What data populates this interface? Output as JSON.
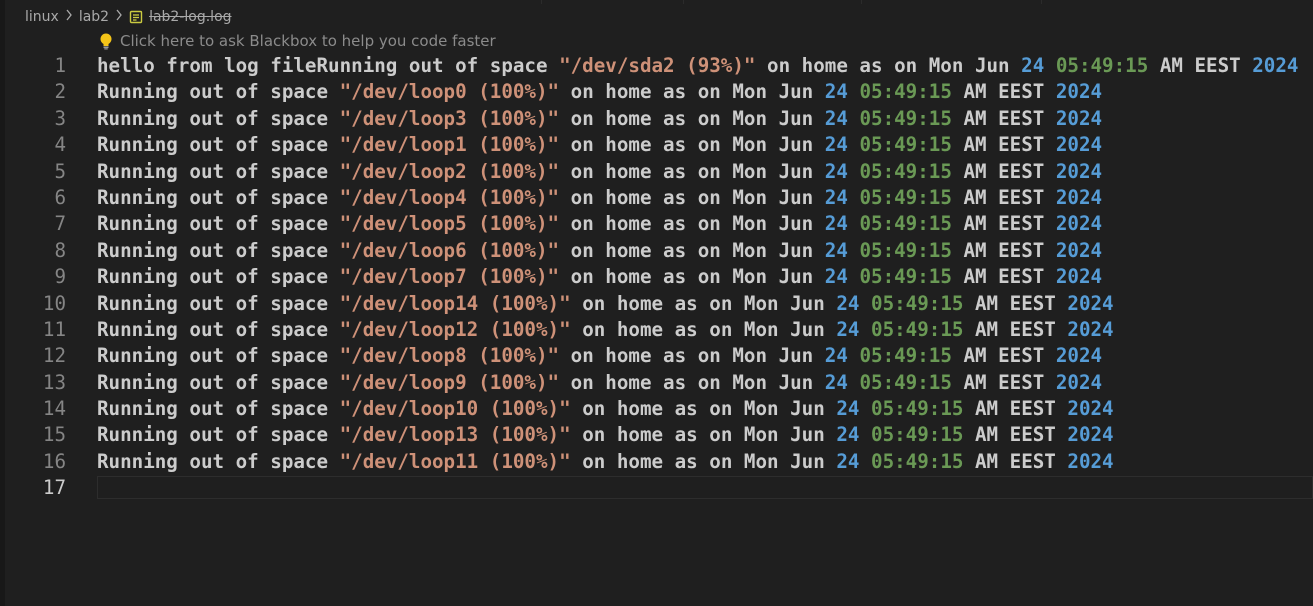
{
  "breadcrumb": {
    "items": [
      "linux",
      "lab2"
    ],
    "file_name": "lab2-log.log"
  },
  "hint": {
    "text": "Click here to ask Blackbox to help you code faster",
    "icon": "lightbulb-icon"
  },
  "colors": {
    "background": "#1f1f1f",
    "text": "#cccccc",
    "string": "#ce9178",
    "number": "#569cd6",
    "time": "#6a9955",
    "line_number": "#858585"
  },
  "lines": [
    {
      "n": "1",
      "pre": "hello from log fileRunning out of space ",
      "path": "\"/dev/sda2 (93%)\"",
      "mid": " on home as on Mon Jun ",
      "day": "24",
      "time": "05:49:15",
      "tz": " AM EEST ",
      "year": "2024"
    },
    {
      "n": "2",
      "pre": "Running out of space ",
      "path": "\"/dev/loop0 (100%)\"",
      "mid": " on home as on Mon Jun ",
      "day": "24",
      "time": "05:49:15",
      "tz": " AM EEST ",
      "year": "2024"
    },
    {
      "n": "3",
      "pre": "Running out of space ",
      "path": "\"/dev/loop3 (100%)\"",
      "mid": " on home as on Mon Jun ",
      "day": "24",
      "time": "05:49:15",
      "tz": " AM EEST ",
      "year": "2024"
    },
    {
      "n": "4",
      "pre": "Running out of space ",
      "path": "\"/dev/loop1 (100%)\"",
      "mid": " on home as on Mon Jun ",
      "day": "24",
      "time": "05:49:15",
      "tz": " AM EEST ",
      "year": "2024"
    },
    {
      "n": "5",
      "pre": "Running out of space ",
      "path": "\"/dev/loop2 (100%)\"",
      "mid": " on home as on Mon Jun ",
      "day": "24",
      "time": "05:49:15",
      "tz": " AM EEST ",
      "year": "2024"
    },
    {
      "n": "6",
      "pre": "Running out of space ",
      "path": "\"/dev/loop4 (100%)\"",
      "mid": " on home as on Mon Jun ",
      "day": "24",
      "time": "05:49:15",
      "tz": " AM EEST ",
      "year": "2024"
    },
    {
      "n": "7",
      "pre": "Running out of space ",
      "path": "\"/dev/loop5 (100%)\"",
      "mid": " on home as on Mon Jun ",
      "day": "24",
      "time": "05:49:15",
      "tz": " AM EEST ",
      "year": "2024"
    },
    {
      "n": "8",
      "pre": "Running out of space ",
      "path": "\"/dev/loop6 (100%)\"",
      "mid": " on home as on Mon Jun ",
      "day": "24",
      "time": "05:49:15",
      "tz": " AM EEST ",
      "year": "2024"
    },
    {
      "n": "9",
      "pre": "Running out of space ",
      "path": "\"/dev/loop7 (100%)\"",
      "mid": " on home as on Mon Jun ",
      "day": "24",
      "time": "05:49:15",
      "tz": " AM EEST ",
      "year": "2024"
    },
    {
      "n": "10",
      "pre": "Running out of space ",
      "path": "\"/dev/loop14 (100%)\"",
      "mid": " on home as on Mon Jun ",
      "day": "24",
      "time": "05:49:15",
      "tz": " AM EEST ",
      "year": "2024"
    },
    {
      "n": "11",
      "pre": "Running out of space ",
      "path": "\"/dev/loop12 (100%)\"",
      "mid": " on home as on Mon Jun ",
      "day": "24",
      "time": "05:49:15",
      "tz": " AM EEST ",
      "year": "2024"
    },
    {
      "n": "12",
      "pre": "Running out of space ",
      "path": "\"/dev/loop8 (100%)\"",
      "mid": " on home as on Mon Jun ",
      "day": "24",
      "time": "05:49:15",
      "tz": " AM EEST ",
      "year": "2024"
    },
    {
      "n": "13",
      "pre": "Running out of space ",
      "path": "\"/dev/loop9 (100%)\"",
      "mid": " on home as on Mon Jun ",
      "day": "24",
      "time": "05:49:15",
      "tz": " AM EEST ",
      "year": "2024"
    },
    {
      "n": "14",
      "pre": "Running out of space ",
      "path": "\"/dev/loop10 (100%)\"",
      "mid": " on home as on Mon Jun ",
      "day": "24",
      "time": "05:49:15",
      "tz": " AM EEST ",
      "year": "2024"
    },
    {
      "n": "15",
      "pre": "Running out of space ",
      "path": "\"/dev/loop13 (100%)\"",
      "mid": " on home as on Mon Jun ",
      "day": "24",
      "time": "05:49:15",
      "tz": " AM EEST ",
      "year": "2024"
    },
    {
      "n": "16",
      "pre": "Running out of space ",
      "path": "\"/dev/loop11 (100%)\"",
      "mid": " on home as on Mon Jun ",
      "day": "24",
      "time": "05:49:15",
      "tz": " AM EEST ",
      "year": "2024"
    },
    {
      "n": "17",
      "pre": "",
      "path": "",
      "mid": "",
      "day": "",
      "time": "",
      "tz": "",
      "year": ""
    }
  ]
}
